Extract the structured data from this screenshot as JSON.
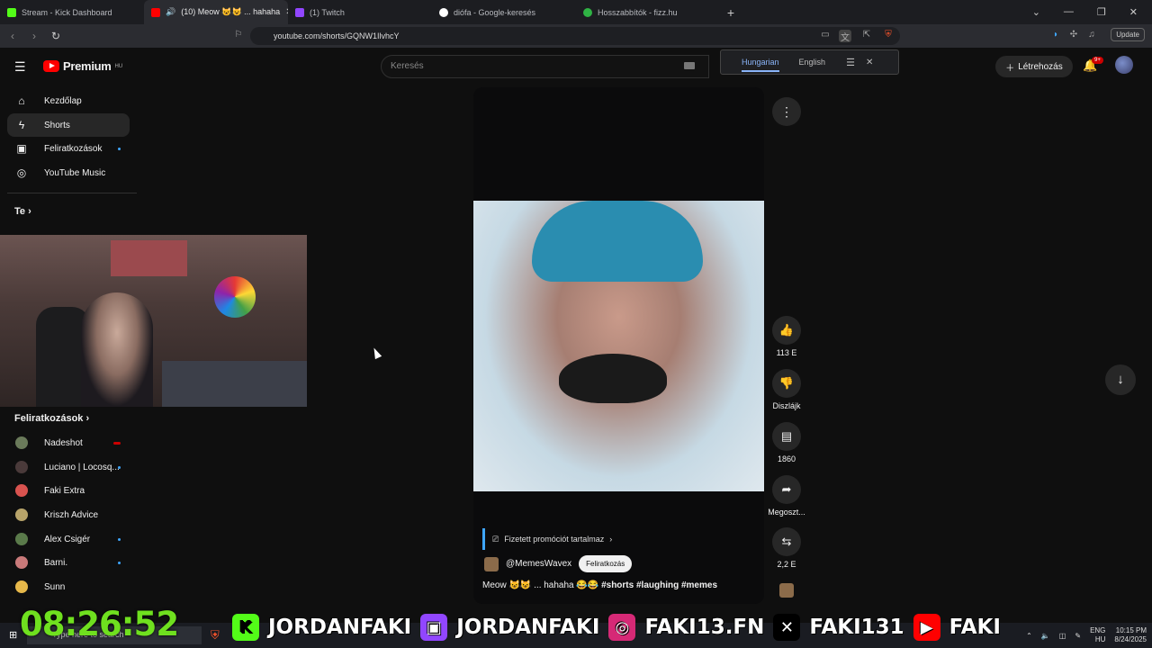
{
  "browser": {
    "tabs": [
      {
        "label": "Stream - Kick Dashboard",
        "color": "#53fc18"
      },
      {
        "label": "(10) Meow 😺😺 ... hahaha",
        "color": "#ff0000"
      },
      {
        "label": "(1) Twitch",
        "color": "#9146ff"
      },
      {
        "label": "diófa - Google-keresés",
        "color": "#ffffff"
      },
      {
        "label": "Hosszabbítók - fizz.hu",
        "color": "#2fb344"
      }
    ],
    "url": "youtube.com/shorts/GQNW1IlvhcY",
    "update_label": "Update"
  },
  "translate_popup": {
    "from": "Hungarian",
    "to": "English"
  },
  "header": {
    "logo": "Premium",
    "region": "HU",
    "search_placeholder": "Keresés",
    "create_label": "Létrehozás",
    "notif_count": "9+"
  },
  "sidebar": {
    "items": [
      {
        "label": "Kezdőlap",
        "icon": "home-icon"
      },
      {
        "label": "Shorts",
        "icon": "shorts-icon"
      },
      {
        "label": "Feliratkozások",
        "icon": "subscriptions-icon"
      },
      {
        "label": "YouTube Music",
        "icon": "music-icon"
      }
    ],
    "you_label": "Te",
    "subs_heading": "Feliratkozások",
    "subs": [
      {
        "name": "Nadeshot",
        "color": "#6a7a5a"
      },
      {
        "name": "Luciano | Locosq...",
        "color": "#4a3a3a"
      },
      {
        "name": "Faki Extra",
        "color": "#d9534f"
      },
      {
        "name": "Kriszh Advice",
        "color": "#b8a46a"
      },
      {
        "name": "Alex Csigér",
        "color": "#5a7a4a"
      },
      {
        "name": "Barni.",
        "color": "#c97a7a"
      },
      {
        "name": "Sunn",
        "color": "#e6b84a"
      }
    ]
  },
  "short": {
    "promo_text": "Fizetett promóciót tartalmaz",
    "channel": "@MemesWavex",
    "subscribe_label": "Feliratkozás",
    "description": "Meow 😺😺 ... hahaha 😂😂",
    "hashtags": "#shorts #laughing #memes"
  },
  "actions": {
    "likes": "113 E",
    "dislike_label": "Diszlájk",
    "comments": "1860",
    "share_label": "Megoszt...",
    "remix_count": "2,2 E"
  },
  "overlay": {
    "timer": "08:26:52",
    "socials": [
      "JORDANFAKI",
      "JORDANFAKI",
      "FAKI13.FN",
      "FAKI131",
      "FAKI"
    ]
  },
  "taskbar": {
    "search_placeholder": "Type here to search",
    "lang": "ENG",
    "lang2": "HU",
    "time": "10:15 PM",
    "date": "8/24/2025"
  }
}
